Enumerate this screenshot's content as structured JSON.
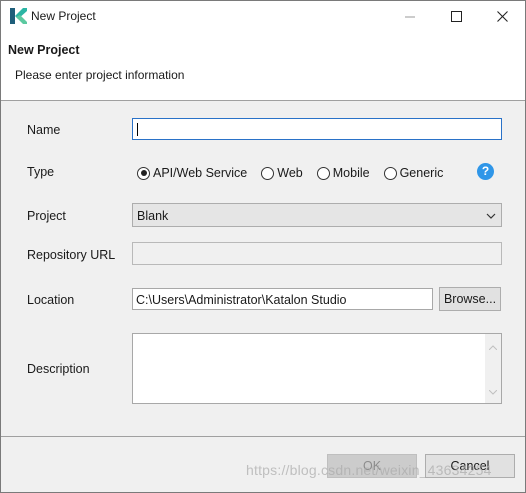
{
  "window": {
    "title": "New Project",
    "app_icon": "katalon-logo-icon"
  },
  "header": {
    "title": "New Project",
    "message": "Please enter project information"
  },
  "form": {
    "name_label": "Name",
    "name_value": "",
    "type_label": "Type",
    "type_options": [
      {
        "label": "API/Web Service",
        "selected": true
      },
      {
        "label": "Web",
        "selected": false
      },
      {
        "label": "Mobile",
        "selected": false
      },
      {
        "label": "Generic",
        "selected": false
      }
    ],
    "help_symbol": "?",
    "project_label": "Project",
    "project_value": "Blank",
    "repo_label": "Repository URL",
    "repo_value": "",
    "location_label": "Location",
    "location_value": "C:\\Users\\Administrator\\Katalon Studio",
    "browse_label": "Browse...",
    "description_label": "Description",
    "description_value": ""
  },
  "footer": {
    "ok_label": "OK",
    "cancel_label": "Cancel"
  },
  "watermark": "https://blog.csdn.net/weixin_43634254",
  "colors": {
    "accent_border": "#2a72c8",
    "help_icon": "#2f96e8",
    "logo_teal": "#2bb5a4",
    "logo_dark": "#1e5e7a"
  }
}
